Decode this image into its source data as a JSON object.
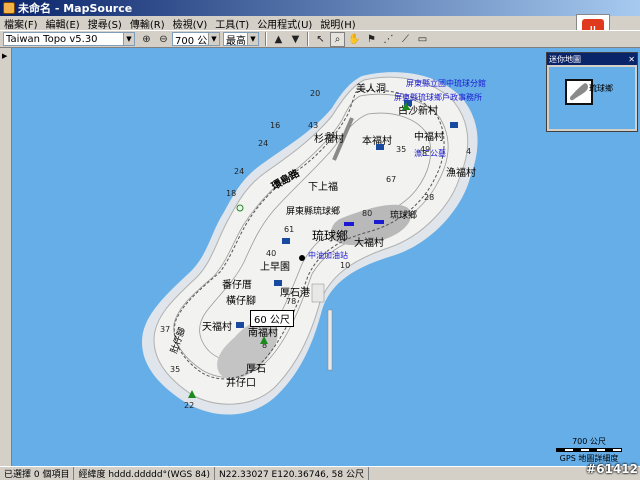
{
  "window": {
    "title": "未命名 - MapSource"
  },
  "menus": [
    "檔案(F)",
    "編輯(E)",
    "搜尋(S)",
    "傳輸(R)",
    "檢視(V)",
    "工具(T)",
    "公用程式(U)",
    "說明(H)"
  ],
  "toolbar": {
    "map_product": "Taiwan Topo v5.30",
    "zoom_level": "700 公尺",
    "detail_level": "最高"
  },
  "overview": {
    "title": "迷你地圖",
    "label": "琉球鄉"
  },
  "map": {
    "labels": [
      {
        "id": "village-meiren",
        "text": "美人洞"
      },
      {
        "id": "village-baisha",
        "text": "白沙新村"
      },
      {
        "id": "village-shanfu",
        "text": "杉福村"
      },
      {
        "id": "village-benfu",
        "text": "本福村"
      },
      {
        "id": "village-zhongfu",
        "text": "中福村"
      },
      {
        "id": "village-yufu",
        "text": "漁福村"
      },
      {
        "id": "road-huandao",
        "text": "環島路"
      },
      {
        "id": "village-xiashang",
        "text": "下上福"
      },
      {
        "id": "office-township",
        "text": "屏東縣琉球鄉"
      },
      {
        "id": "place-liuqiu",
        "text": "琉球鄉"
      },
      {
        "id": "place-liuqiu-2",
        "text": "琉球鄉"
      },
      {
        "id": "village-dafu",
        "text": "大福村"
      },
      {
        "id": "place-shangliao",
        "text": "上早園"
      },
      {
        "id": "place-fanzi",
        "text": "番仔厝"
      },
      {
        "id": "place-henggen",
        "text": "橫仔腳"
      },
      {
        "id": "place-zhuliao",
        "text": "肚仔腳"
      },
      {
        "id": "village-tianfu",
        "text": "天福村"
      },
      {
        "id": "village-nanfu",
        "text": "南福村"
      },
      {
        "id": "place-liuqiu-sw",
        "text": "厚石"
      },
      {
        "id": "place-jingzai",
        "text": "井仔口"
      },
      {
        "id": "place-shihhu",
        "text": "厚石港"
      },
      {
        "id": "poi-school",
        "text": "屏東縣立國中琉球分館"
      },
      {
        "id": "poi-office",
        "text": "屏東縣琉球鄉戶政事務所"
      },
      {
        "id": "poi-park",
        "text": "漁二公墓"
      },
      {
        "id": "poi-gas",
        "text": "中油加油站"
      }
    ],
    "callout": "60 公尺",
    "scale_text": "700 公尺",
    "scale_note": "GPS 地圖詳細度"
  },
  "status": {
    "selection": "已選擇 0 個項目",
    "format": "經緯度 hddd.ddddd°(WGS 84)",
    "coords": "N22.33027 E120.36746, 58 公尺"
  },
  "watermark": "#61412"
}
